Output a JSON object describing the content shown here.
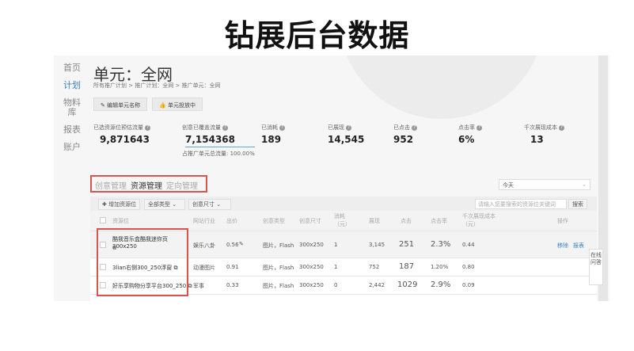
{
  "title": "钻展后台数据",
  "nav": [
    "首页",
    "计划",
    "物料库",
    "报表",
    "账户"
  ],
  "unit_title": "单元：全网",
  "breadcrumb": "所有推广计划 > 推广计划：全网 > 推广单元：全网",
  "buttons": {
    "edit": "编辑单元名称",
    "status": "单元投放中"
  },
  "stats": [
    {
      "label": "已选资源位预估流量",
      "value": "9,871643"
    },
    {
      "label": "创意已覆盖流量",
      "value": "7,154368"
    },
    {
      "label": "已消耗",
      "value": "189"
    },
    {
      "label": "已展现",
      "value": "14,545"
    },
    {
      "label": "已点击",
      "value": "952"
    },
    {
      "label": "点击率",
      "value": "6%"
    },
    {
      "label": "千次展现成本",
      "value": "13"
    }
  ],
  "coverage": "占推广单元总流量: 100.00%",
  "tabs": [
    "创意管理",
    "资源管理",
    "定向管理"
  ],
  "date_select": "今天",
  "toolbar": {
    "add": "增加资源位",
    "type": "全部类型",
    "size": "创意尺寸",
    "search_placeholder": "请输入您要搜索的资源位关键词",
    "search": "搜索"
  },
  "headers": [
    "资源位",
    "网站行业",
    "出价",
    "创意类型",
    "创意尺寸",
    "消耗（元）",
    "展现",
    "点击",
    "点击率",
    "千次展现成本（元）",
    "操作"
  ],
  "rows": [
    {
      "name": "酷我音乐盒酷我迷你页300x250",
      "industry": "娱乐八卦",
      "bid": "0.56",
      "type": "图片，Flash",
      "size": "300x250",
      "cost": "1",
      "views": "3,145",
      "clicks": "251",
      "ctr": "2.3%",
      "cpm": "0.44",
      "ops": [
        "移除",
        "报表"
      ]
    },
    {
      "name": "3lian右侧300_250浮窗",
      "industry": "动漫图片",
      "bid": "0.91",
      "type": "图片，Flash",
      "size": "300x250",
      "cost": "1",
      "views": "752",
      "clicks": "187",
      "ctr": "1.20%",
      "cpm": "0.80"
    },
    {
      "name": "好乐享购物分享平台300_250",
      "industry": "军事",
      "bid": "0.33",
      "type": "图片，Flash",
      "size": "300x250",
      "cost": "0",
      "views": "2,442",
      "clicks": "1029",
      "ctr": "2.9%",
      "cpm": "0.09"
    }
  ],
  "online_help": "在线问答"
}
